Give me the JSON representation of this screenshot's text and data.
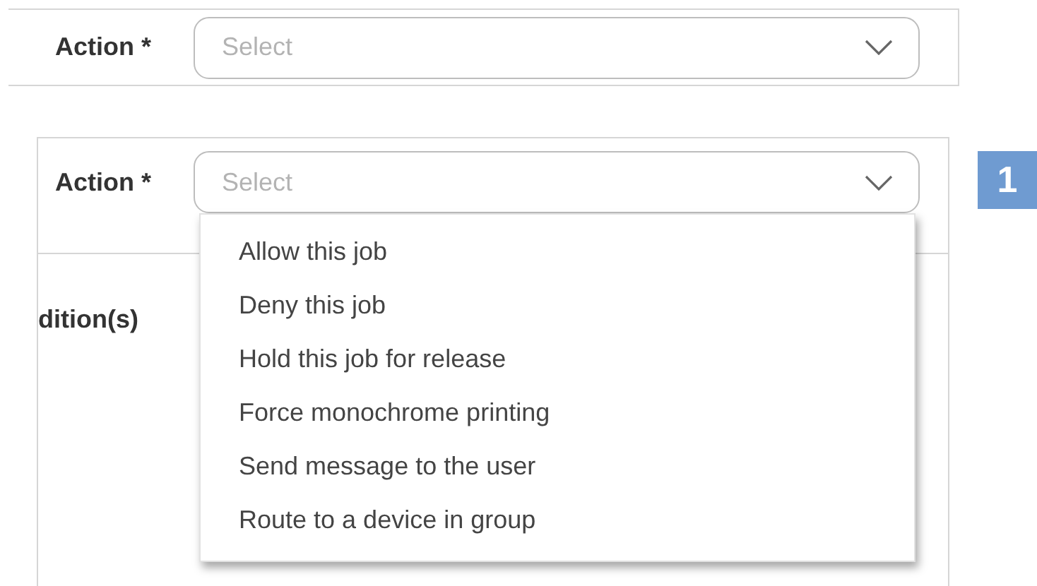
{
  "top_form": {
    "action_label": "Action *",
    "action_select": {
      "placeholder": "Select"
    }
  },
  "open_form": {
    "action_label": "Action *",
    "action_select": {
      "placeholder": "Select",
      "expanded": true
    },
    "conditions_label": "dition(s)",
    "options": [
      {
        "label": "Allow this job"
      },
      {
        "label": "Deny this job"
      },
      {
        "label": "Hold this job for release"
      },
      {
        "label": "Force monochrome printing"
      },
      {
        "label": "Send message to the user"
      },
      {
        "label": "Route to a device in group"
      }
    ]
  },
  "step_badge": "1"
}
